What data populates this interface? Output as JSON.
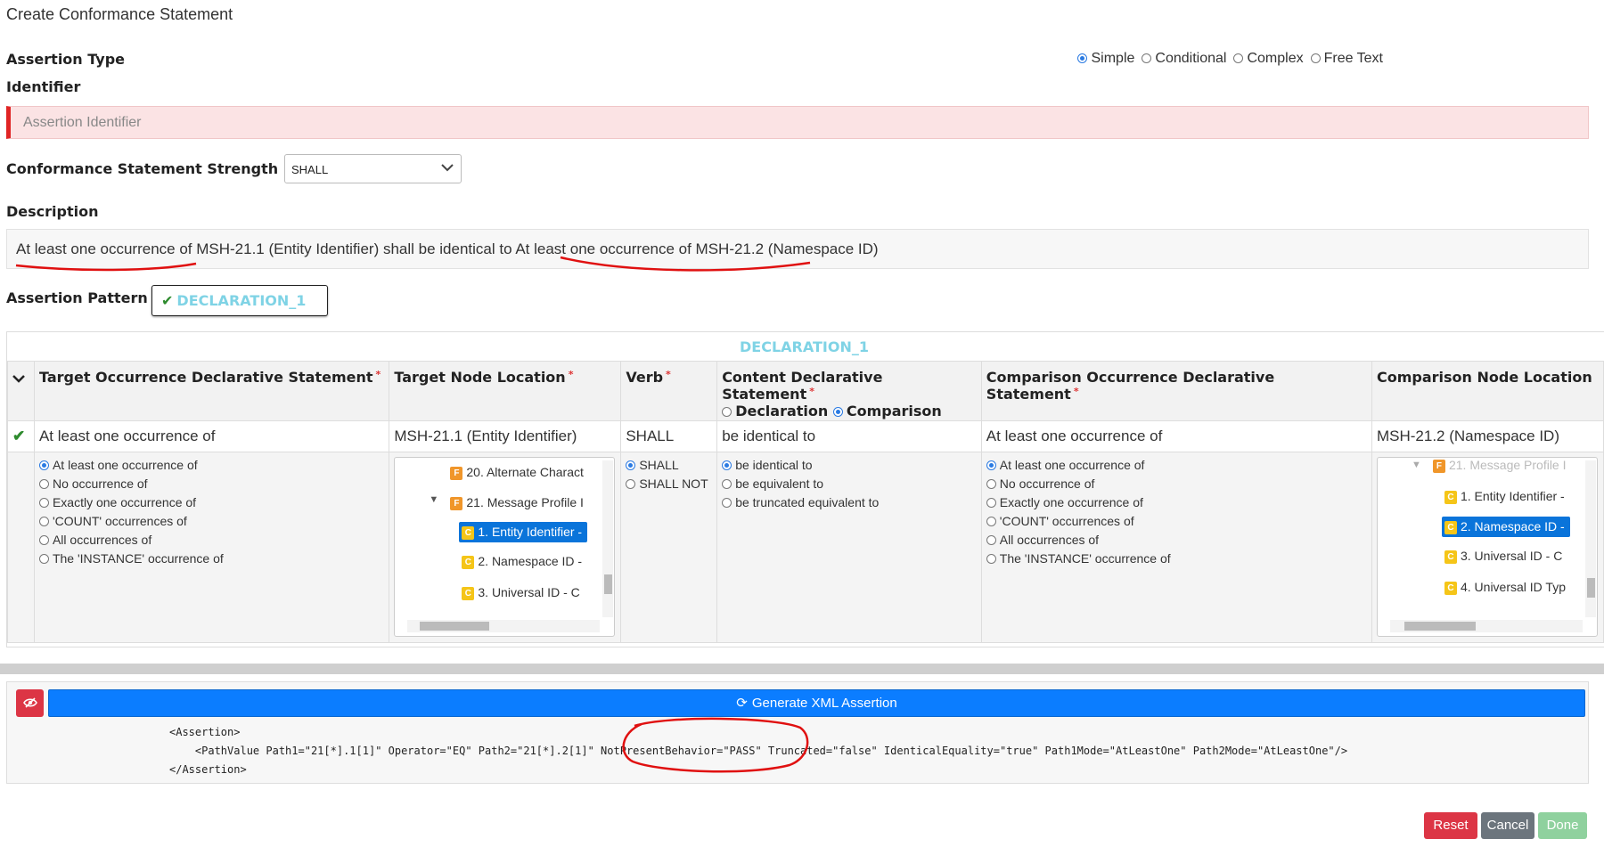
{
  "title": "Create Conformance Statement",
  "assertion_type": {
    "label": "Assertion Type",
    "options": [
      "Simple",
      "Conditional",
      "Complex",
      "Free Text"
    ],
    "selected": "Simple"
  },
  "identifier": {
    "label": "Identifier",
    "placeholder": "Assertion Identifier"
  },
  "strength": {
    "label": "Conformance Statement Strength",
    "value": "SHALL"
  },
  "description": {
    "label": "Description",
    "text": "At least one occurrence of MSH-21.1 (Entity Identifier) shall be identical to At least one occurrence of MSH-21.2 (Namespace ID)"
  },
  "pattern": {
    "label": "Assertion Pattern",
    "button": "DECLARATION_1"
  },
  "panel_title": "DECLARATION_1",
  "columns": {
    "target_occ": "Target Occurrence Declarative Statement",
    "target_node": "Target Node Location",
    "verb": "Verb",
    "content": "Content Declarative Statement",
    "content_opt_decl": "Declaration",
    "content_opt_comp": "Comparison",
    "comp_occ": "Comparison Occurrence Declarative Statement",
    "comp_node": "Comparison Node Location"
  },
  "values": {
    "target_occ": "At least one occurrence of",
    "target_node": "MSH-21.1 (Entity Identifier)",
    "verb": "SHALL",
    "content": "be identical to",
    "comp_occ": "At least one occurrence of",
    "comp_node": "MSH-21.2 (Namespace ID)"
  },
  "occurrence_options": [
    "At least one occurrence of",
    "No occurrence of",
    "Exactly one occurrence of",
    "'COUNT' occurrences of",
    "All occurrences of",
    "The 'INSTANCE' occurrence of"
  ],
  "verb_options": [
    "SHALL",
    "SHALL NOT"
  ],
  "content_options": [
    "be identical to",
    "be equivalent to",
    "be truncated equivalent to"
  ],
  "target_tree": {
    "n1": "20. Alternate Charact",
    "n2": "21. Message Profile I",
    "n3": "1. Entity Identifier -",
    "n4": "2. Namespace ID -",
    "n5": "3. Universal ID - C"
  },
  "comp_tree": {
    "n1": "21. Message Profile I",
    "n2": "1. Entity Identifier -",
    "n3": "2. Namespace ID -",
    "n4": "3. Universal ID - C",
    "n5": "4. Universal ID Typ"
  },
  "badges": {
    "field": "F",
    "component": "C"
  },
  "generate_button": "Generate XML Assertion",
  "xml": {
    "line1": "<Assertion>",
    "line2": "    <PathValue Path1=\"21[*].1[1]\" Operator=\"EQ\" Path2=\"21[*].2[1]\" NotPresentBehavior=\"PASS\" Truncated=\"false\" IdenticalEquality=\"true\" Path1Mode=\"AtLeastOne\" Path2Mode=\"AtLeastOne\"/>",
    "line3": "</Assertion>"
  },
  "footer": {
    "reset": "Reset",
    "cancel": "Cancel",
    "done": "Done"
  },
  "colors": {
    "primary": "#0b7dff",
    "danger": "#dc3545",
    "secondary": "#6c757d",
    "success_light": "#8fd19e",
    "accent_cyan": "#7fd3e5"
  }
}
